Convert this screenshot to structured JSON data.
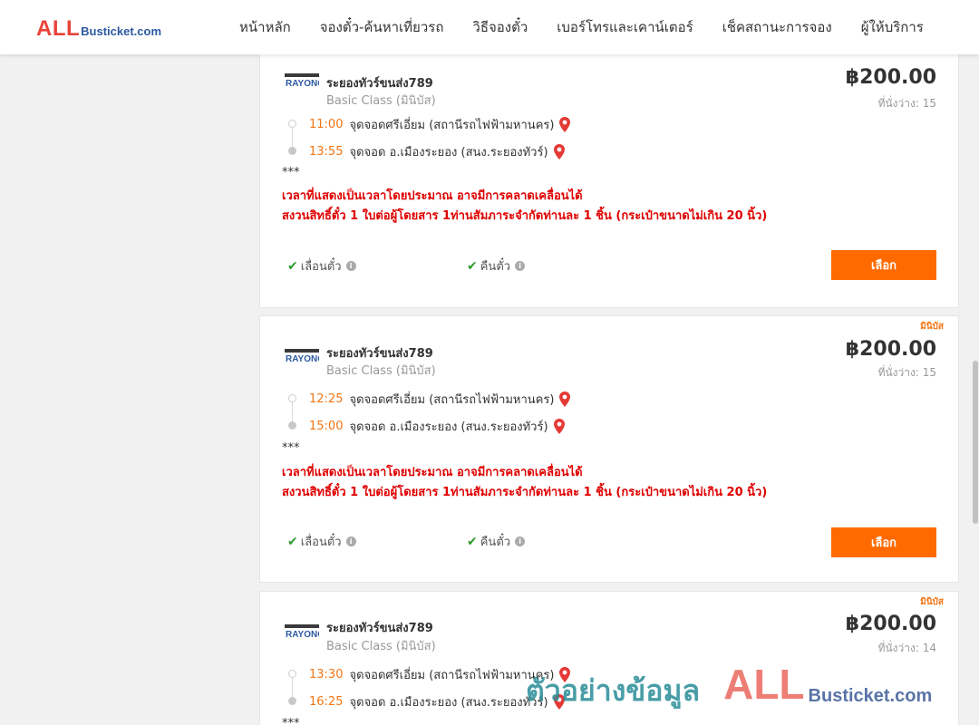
{
  "header": {
    "logo": {
      "all": "ALL",
      "rest": "Busticket.com"
    },
    "nav": [
      "หน้าหลัก",
      "จองตั๋ว-ค้นหาเที่ยวรถ",
      "วิธีจองตั๋ว",
      "เบอร์โทรและเคาน์เตอร์",
      "เช็คสถานะการจอง",
      "ผู้ให้บริการ"
    ]
  },
  "trips": [
    {
      "tag": "",
      "operator": "ระยองทัวร์ขนส่ง789",
      "bus_class": "Basic Class (มินิบัส)",
      "price": "฿200.00",
      "seats": "ที่นั่งว่าง: 15",
      "depart_time": "11:00",
      "depart_place": "จุดจอดศรีเอี่ยม (สถานีรถไฟฟ้ามหานคร)",
      "arrive_time": "13:55",
      "arrive_place": "จุดจอด อ.เมืองระยอง (สนง.ระยองทัวร์)",
      "stars": "***",
      "notice1": "เวลาที่แสดงเป็นเวลาโดยประมาณ อาจมีการคลาดเคลื่อนได้",
      "notice2": "สงวนสิทธิ์ตั๋ว 1 ใบต่อผู้โดยสาร 1ท่านสัมภาระจำกัดท่านละ 1 ชิ้น (กระเป๋าขนาดไม่เกิน 20 นิ้ว)",
      "feature1": "เลื่อนตั๋ว",
      "feature2": "คืนตั๋ว",
      "select": "เลือก"
    },
    {
      "tag": "มินิบัส",
      "operator": "ระยองทัวร์ขนส่ง789",
      "bus_class": "Basic Class (มินิบัส)",
      "price": "฿200.00",
      "seats": "ที่นั่งว่าง: 15",
      "depart_time": "12:25",
      "depart_place": "จุดจอดศรีเอี่ยม (สถานีรถไฟฟ้ามหานคร)",
      "arrive_time": "15:00",
      "arrive_place": "จุดจอด อ.เมืองระยอง (สนง.ระยองทัวร์)",
      "stars": "***",
      "notice1": "เวลาที่แสดงเป็นเวลาโดยประมาณ อาจมีการคลาดเคลื่อนได้",
      "notice2": "สงวนสิทธิ์ตั๋ว 1 ใบต่อผู้โดยสาร 1ท่านสัมภาระจำกัดท่านละ 1 ชิ้น (กระเป๋าขนาดไม่เกิน 20 นิ้ว)",
      "feature1": "เลื่อนตั๋ว",
      "feature2": "คืนตั๋ว",
      "select": "เลือก"
    },
    {
      "tag": "มินิบัส",
      "operator": "ระยองทัวร์ขนส่ง789",
      "bus_class": "Basic Class (มินิบัส)",
      "price": "฿200.00",
      "seats": "ที่นั่งว่าง: 14",
      "depart_time": "13:30",
      "depart_place": "จุดจอดศรีเอี่ยม (สถานีรถไฟฟ้ามหานคร)",
      "arrive_time": "16:25",
      "arrive_place": "จุดจอด อ.เมืองระยอง (สนง.ระยองทัวร์)",
      "stars": "***",
      "notice1": "",
      "notice2": "",
      "feature1": "",
      "feature2": "",
      "select": ""
    }
  ],
  "watermark": {
    "text": "ตัวอย่างข้อมูล",
    "all": "ALL",
    "rest": "Busticket.com"
  },
  "colors": {
    "accent": "#ff6a00",
    "time": "#f47514",
    "notice": "#e00000",
    "check": "#2e9b2e",
    "pin": "#e53935"
  }
}
